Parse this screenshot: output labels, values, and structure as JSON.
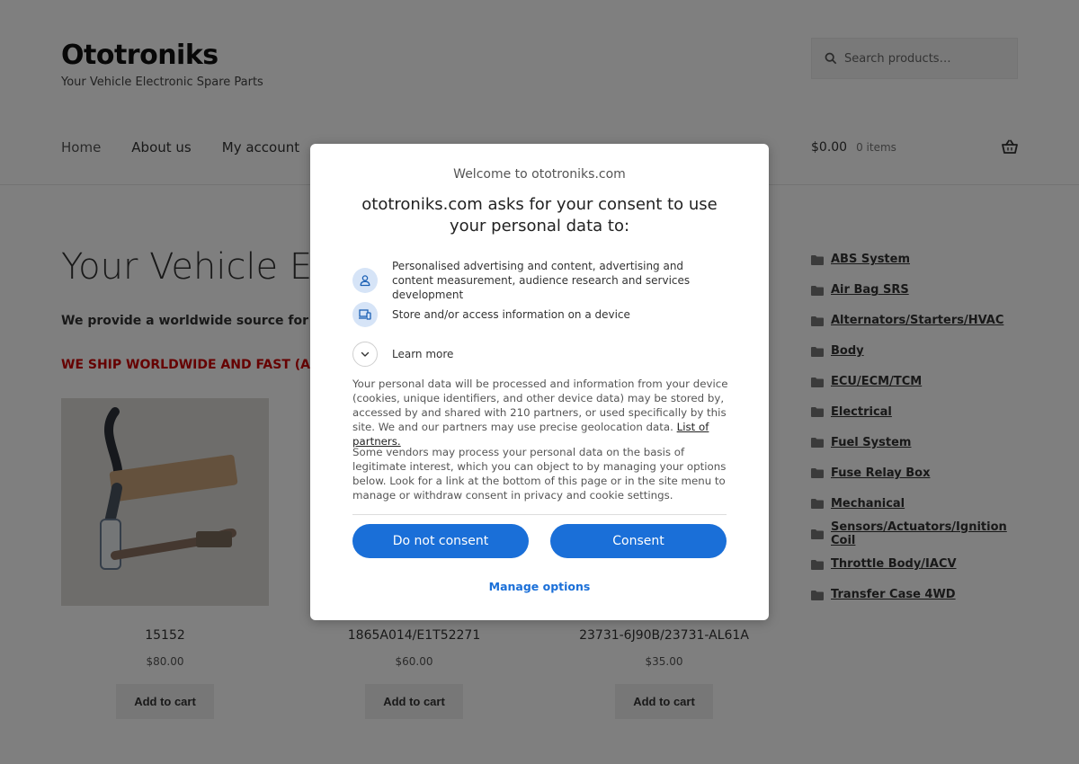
{
  "header": {
    "site_title": "Ototroniks",
    "tagline": "Your Vehicle Electronic Spare Parts",
    "search_placeholder": "Search products…"
  },
  "nav": {
    "items": [
      "Home",
      "About us",
      "My account"
    ]
  },
  "cart": {
    "amount": "$0.00",
    "count": "0 items"
  },
  "main": {
    "title": "Your Vehicle Elect",
    "intro": "We provide a worldwide source for auto",
    "shipping": "WE SHIP WORLDWIDE AND FAST (All price"
  },
  "products": [
    {
      "name": "15152",
      "price": "$80.00",
      "button": "Add to cart"
    },
    {
      "name": "1865A014/E1T52271",
      "price": "$60.00",
      "button": "Add to cart"
    },
    {
      "name": "23731-6J90B/23731-AL61A",
      "price": "$35.00",
      "button": "Add to cart"
    }
  ],
  "sidebar": {
    "categories": [
      "ABS System",
      "Air Bag SRS",
      "Alternators/Starters/HVAC",
      "Body",
      "ECU/ECM/TCM",
      "Electrical",
      "Fuel System",
      "Fuse Relay Box",
      "Mechanical",
      "Sensors/Actuators/Ignition Coil",
      "Throttle Body/IACV",
      "Transfer Case 4WD"
    ]
  },
  "consent": {
    "welcome": "Welcome to ototroniks.com",
    "heading": "ototroniks.com asks for your consent to use your personal data to:",
    "purpose_1": "Personalised advertising and content, advertising and content measurement, audience research and services development",
    "purpose_2": "Store and/or access information on a device",
    "learn_more": "Learn more",
    "para_1": "Your personal data will be processed and information from your device (cookies, unique identifiers, and other device data) may be stored by, accessed by and shared with 210 partners, or used specifically by this site. We and our partners may use precise geolocation data.",
    "partners_link": "List of partners.",
    "para_2": "Some vendors may process your personal data on the basis of legitimate interest, which you can object to by managing your options below. Look for a link at the bottom of this page or in the site menu to manage or withdraw consent in privacy and cookie settings.",
    "do_not_consent": "Do not consent",
    "consent": "Consent",
    "manage_options": "Manage options"
  },
  "colors": {
    "accent": "#1a6fd8",
    "shipping_text": "#cc0000",
    "overlay": "rgba(0,0,0,0.5)"
  }
}
